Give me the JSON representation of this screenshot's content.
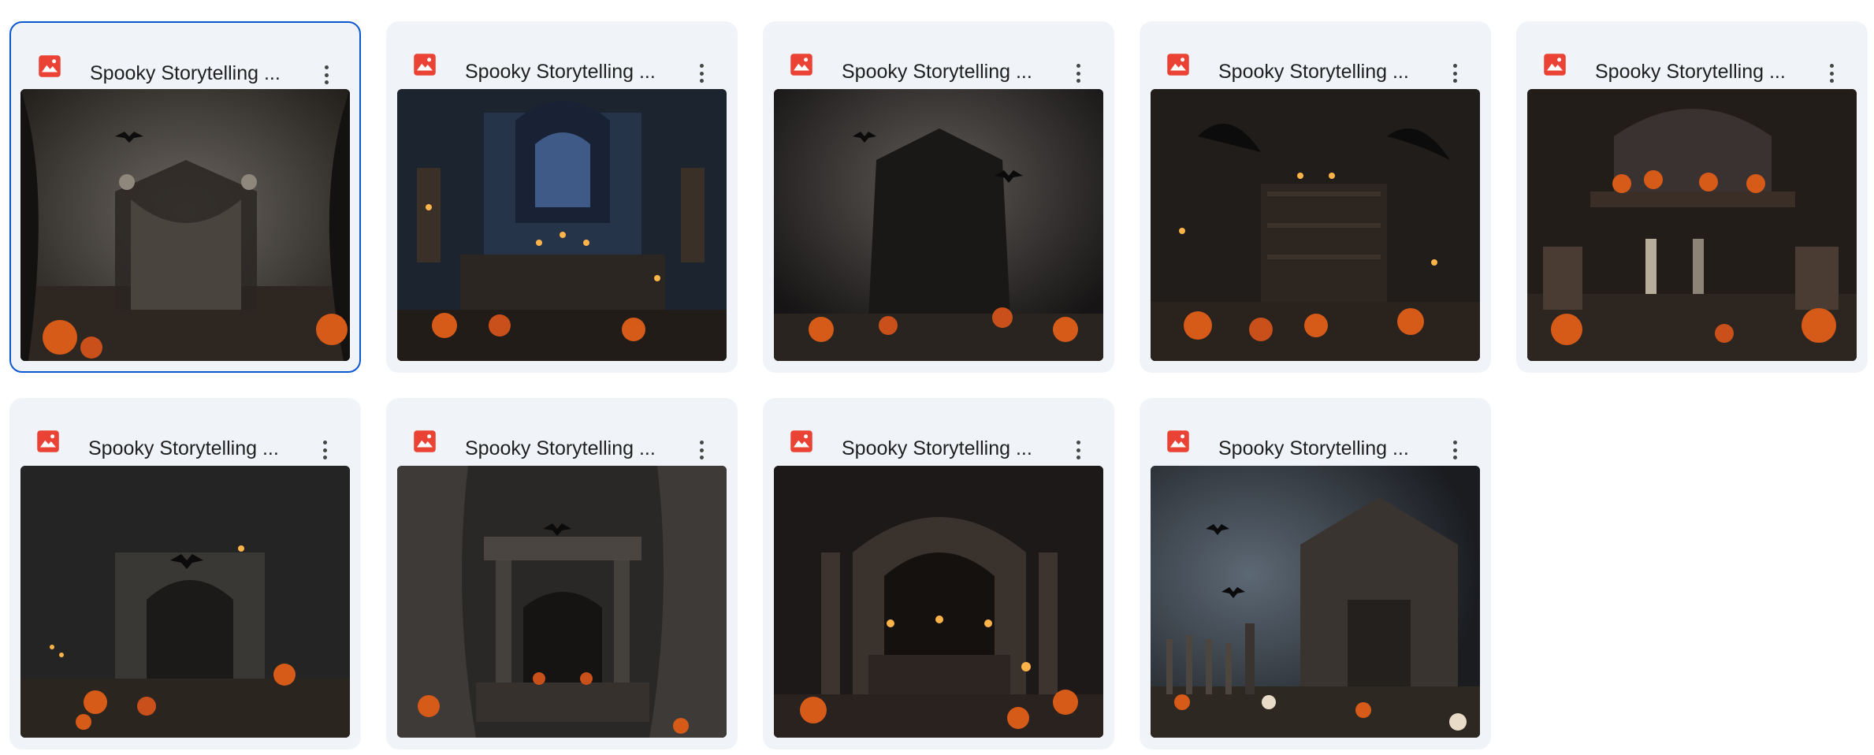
{
  "files": [
    {
      "name": "Spooky Storytelling ...",
      "selected": true,
      "scene": "tent"
    },
    {
      "name": "Spooky Storytelling ...",
      "selected": false,
      "scene": "altar-blue"
    },
    {
      "name": "Spooky Storytelling ...",
      "selected": false,
      "scene": "fog-shrine"
    },
    {
      "name": "Spooky Storytelling ...",
      "selected": false,
      "scene": "bookshelf"
    },
    {
      "name": "Spooky Storytelling ...",
      "selected": false,
      "scene": "mantel"
    },
    {
      "name": "Spooky Storytelling ...",
      "selected": false,
      "scene": "gate"
    },
    {
      "name": "Spooky Storytelling ...",
      "selected": false,
      "scene": "curtain"
    },
    {
      "name": "Spooky Storytelling ...",
      "selected": false,
      "scene": "arch-candles"
    },
    {
      "name": "Spooky Storytelling ...",
      "selected": false,
      "scene": "shack"
    }
  ],
  "icons": {
    "file_type": "image-file-icon",
    "more": "more-vert-icon"
  },
  "colors": {
    "card_bg": "#f0f4f9",
    "selected_border": "#0b57d0",
    "image_icon": "#ea4335",
    "pumpkin": "#e0621a"
  }
}
